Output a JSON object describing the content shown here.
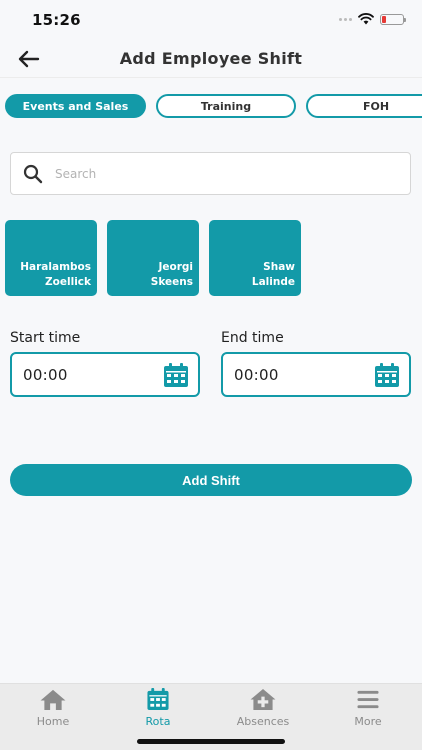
{
  "status_bar": {
    "time": "15:26"
  },
  "header": {
    "title": "Add Employee Shift"
  },
  "tabs": [
    {
      "label": "Events and Sales",
      "active": true
    },
    {
      "label": "Training",
      "active": false
    },
    {
      "label": "FOH",
      "active": false
    }
  ],
  "search": {
    "placeholder": "Search",
    "value": ""
  },
  "employees": [
    {
      "first": "Haralambos",
      "last": "Zoellick"
    },
    {
      "first": "Jeorgi",
      "last": "Skeens"
    },
    {
      "first": "Shaw",
      "last": "Lalinde"
    }
  ],
  "start_time": {
    "label": "Start time",
    "value": "00:00"
  },
  "end_time": {
    "label": "End time",
    "value": "00:00"
  },
  "add_shift": {
    "label": "Add Shift"
  },
  "nav": [
    {
      "label": "Home",
      "icon": "home-icon",
      "active": false
    },
    {
      "label": "Rota",
      "icon": "calendar-icon",
      "active": true
    },
    {
      "label": "Absences",
      "icon": "medical-house-icon",
      "active": false
    },
    {
      "label": "More",
      "icon": "menu-icon",
      "active": false
    }
  ],
  "colors": {
    "accent": "#139aa8",
    "nav_inactive": "#8b8b8b",
    "background": "#f7f8fa"
  }
}
